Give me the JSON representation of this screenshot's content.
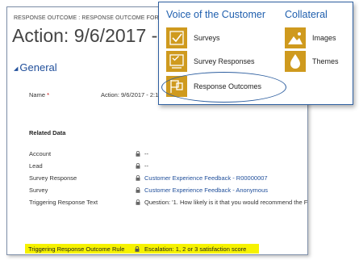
{
  "form": {
    "breadcrumb": "RESPONSE OUTCOME : RESPONSE OUTCOME FORM",
    "title": "Action: 9/6/2017 - 2",
    "section_title": "General",
    "name_label": "Name",
    "name_required": "*",
    "name_value": "Action: 9/6/2017 - 2:1"
  },
  "related": {
    "heading": "Related Data",
    "rows": [
      {
        "label": "Account",
        "value": "--"
      },
      {
        "label": "Lead",
        "value": "--"
      },
      {
        "label": "Survey Response",
        "value": "Customer Experience Feedback - R00000007"
      },
      {
        "label": "Survey",
        "value": "Customer Experience Feedback - Anonymous"
      },
      {
        "label": "Triggering Response Text",
        "value": "Question: '1. How likely is it that you would recommend the F"
      }
    ],
    "highlight_row": {
      "label": "Triggering Response Outcome Rule",
      "value": "Escalation: 1, 2 or 3 satisfaction score"
    }
  },
  "menu": {
    "group1_title": "Voice of the Customer",
    "group2_title": "Collateral",
    "items": [
      {
        "label": "Surveys",
        "icon": "checkbox-icon"
      },
      {
        "label": "Survey Responses",
        "icon": "survey-responses-icon"
      },
      {
        "label": "Response Outcomes",
        "icon": "response-outcomes-icon"
      },
      {
        "label": "Images",
        "icon": "images-icon"
      },
      {
        "label": "Themes",
        "icon": "themes-icon"
      }
    ]
  },
  "colors": {
    "accent": "#1f5fae",
    "tile": "#cf9a1e",
    "highlight": "#f6f200",
    "required": "#c00000"
  }
}
